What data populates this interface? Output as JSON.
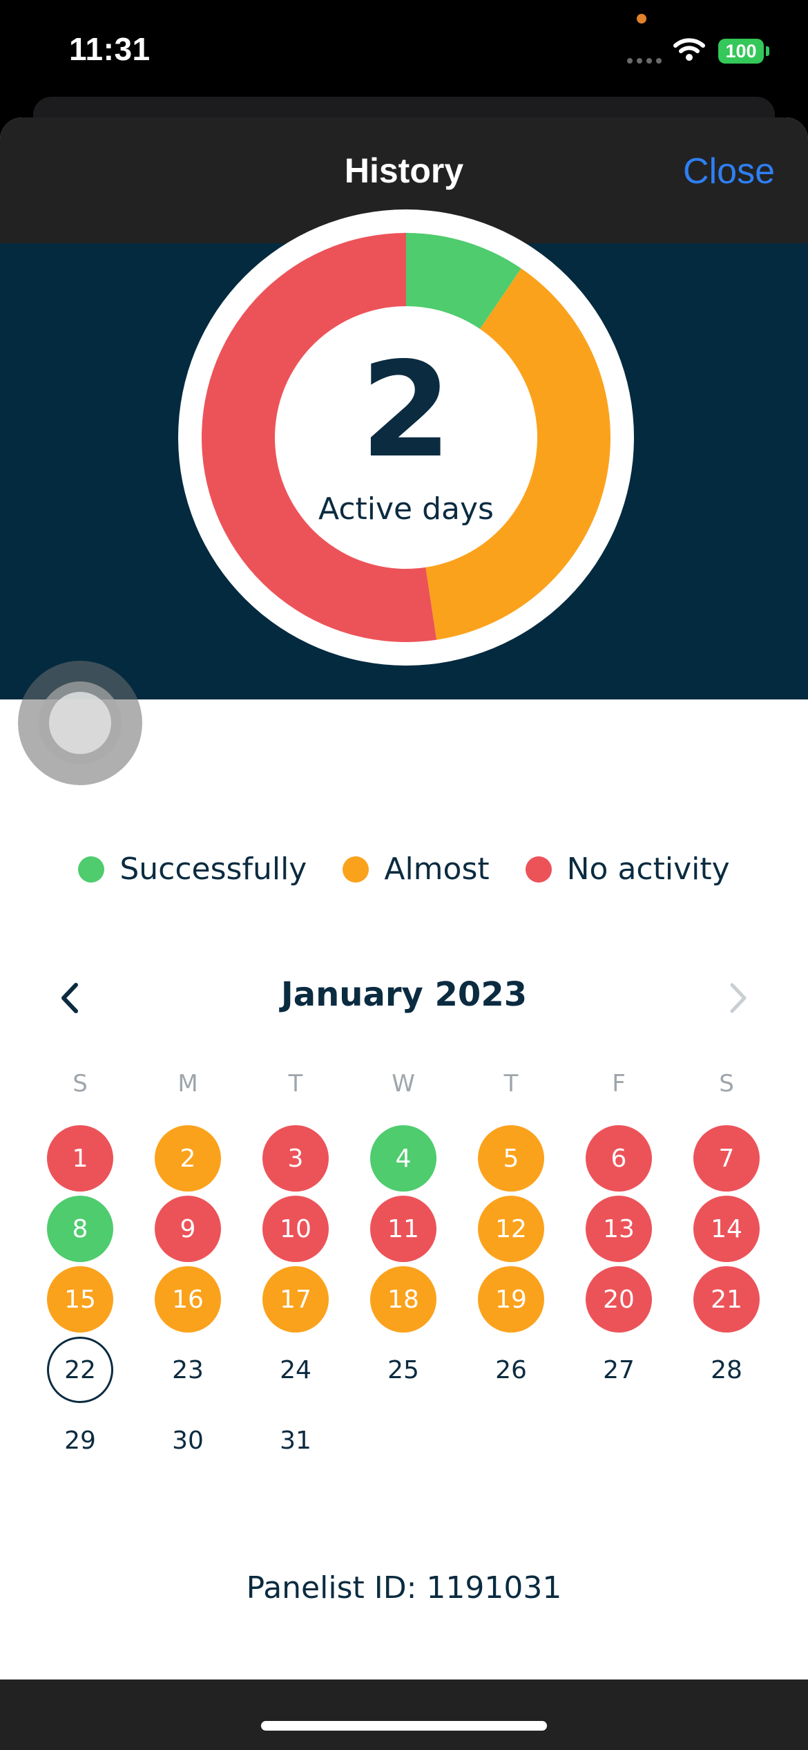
{
  "status_bar": {
    "time": "11:31",
    "battery": "100"
  },
  "nav": {
    "title": "History",
    "close_label": "Close"
  },
  "summary": {
    "value": "2",
    "label": "Active days"
  },
  "colors": {
    "success": "#4fcc6e",
    "almost": "#fba21c",
    "none": "#ec5359",
    "hero": "#042a3f",
    "text": "#0b2b40"
  },
  "chart_data": {
    "type": "pie",
    "categories": [
      "Successfully",
      "Almost",
      "No activity"
    ],
    "values": [
      2,
      8,
      11
    ],
    "center_value": "2",
    "center_label": "Active days"
  },
  "legend": [
    {
      "label": "Successfully",
      "color": "#4fcc6e"
    },
    {
      "label": "Almost",
      "color": "#fba21c"
    },
    {
      "label": "No activity",
      "color": "#ec5359"
    }
  ],
  "calendar": {
    "title": "January 2023",
    "weekdays": [
      "S",
      "M",
      "T",
      "W",
      "T",
      "F",
      "S"
    ],
    "start_weekday": 0,
    "today": 22,
    "days": [
      {
        "day": "1",
        "status": "none"
      },
      {
        "day": "2",
        "status": "almost"
      },
      {
        "day": "3",
        "status": "none"
      },
      {
        "day": "4",
        "status": "success"
      },
      {
        "day": "5",
        "status": "almost"
      },
      {
        "day": "6",
        "status": "none"
      },
      {
        "day": "7",
        "status": "none"
      },
      {
        "day": "8",
        "status": "success"
      },
      {
        "day": "9",
        "status": "none"
      },
      {
        "day": "10",
        "status": "none"
      },
      {
        "day": "11",
        "status": "none"
      },
      {
        "day": "12",
        "status": "almost"
      },
      {
        "day": "13",
        "status": "none"
      },
      {
        "day": "14",
        "status": "none"
      },
      {
        "day": "15",
        "status": "almost"
      },
      {
        "day": "16",
        "status": "almost"
      },
      {
        "day": "17",
        "status": "almost"
      },
      {
        "day": "18",
        "status": "almost"
      },
      {
        "day": "19",
        "status": "almost"
      },
      {
        "day": "20",
        "status": "none"
      },
      {
        "day": "21",
        "status": "none"
      },
      {
        "day": "22",
        "status": "today"
      },
      {
        "day": "23",
        "status": ""
      },
      {
        "day": "24",
        "status": ""
      },
      {
        "day": "25",
        "status": ""
      },
      {
        "day": "26",
        "status": ""
      },
      {
        "day": "27",
        "status": ""
      },
      {
        "day": "28",
        "status": ""
      },
      {
        "day": "29",
        "status": ""
      },
      {
        "day": "30",
        "status": ""
      },
      {
        "day": "31",
        "status": ""
      }
    ]
  },
  "footer": {
    "panelist_id": "Panelist ID: 1191031"
  }
}
